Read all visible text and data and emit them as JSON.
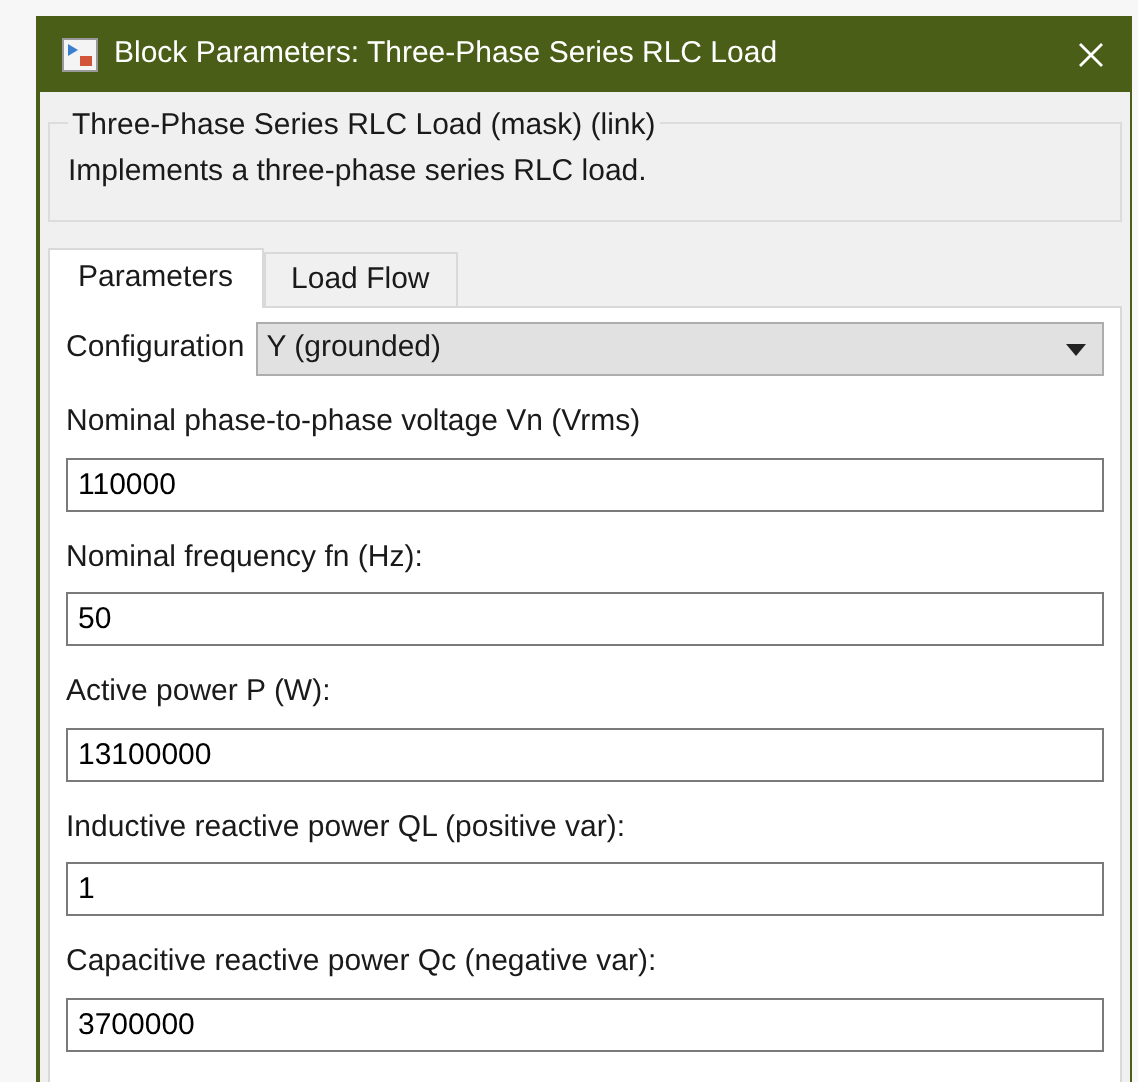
{
  "window": {
    "title": "Block Parameters: Three-Phase Series RLC Load"
  },
  "group": {
    "title": "Three-Phase Series RLC Load (mask) (link)",
    "description": "Implements a three-phase series RLC load."
  },
  "tabs": [
    {
      "label": "Parameters",
      "selected": true
    },
    {
      "label": "Load Flow",
      "selected": false
    }
  ],
  "parameters": [
    {
      "kind": "dropdown",
      "label": "Configuration",
      "value": "Y (grounded)"
    },
    {
      "kind": "text",
      "label": "Nominal phase-to-phase voltage Vn (Vrms)",
      "value": "110000"
    },
    {
      "kind": "text",
      "label": "Nominal frequency fn (Hz):",
      "value": "50"
    },
    {
      "kind": "text",
      "label": "Active power P (W):",
      "value": "13100000"
    },
    {
      "kind": "text",
      "label": "Inductive reactive power QL (positive var):",
      "value": "1"
    },
    {
      "kind": "text",
      "label": "Capacitive reactive power Qc (negative var):",
      "value": "3700000"
    }
  ]
}
